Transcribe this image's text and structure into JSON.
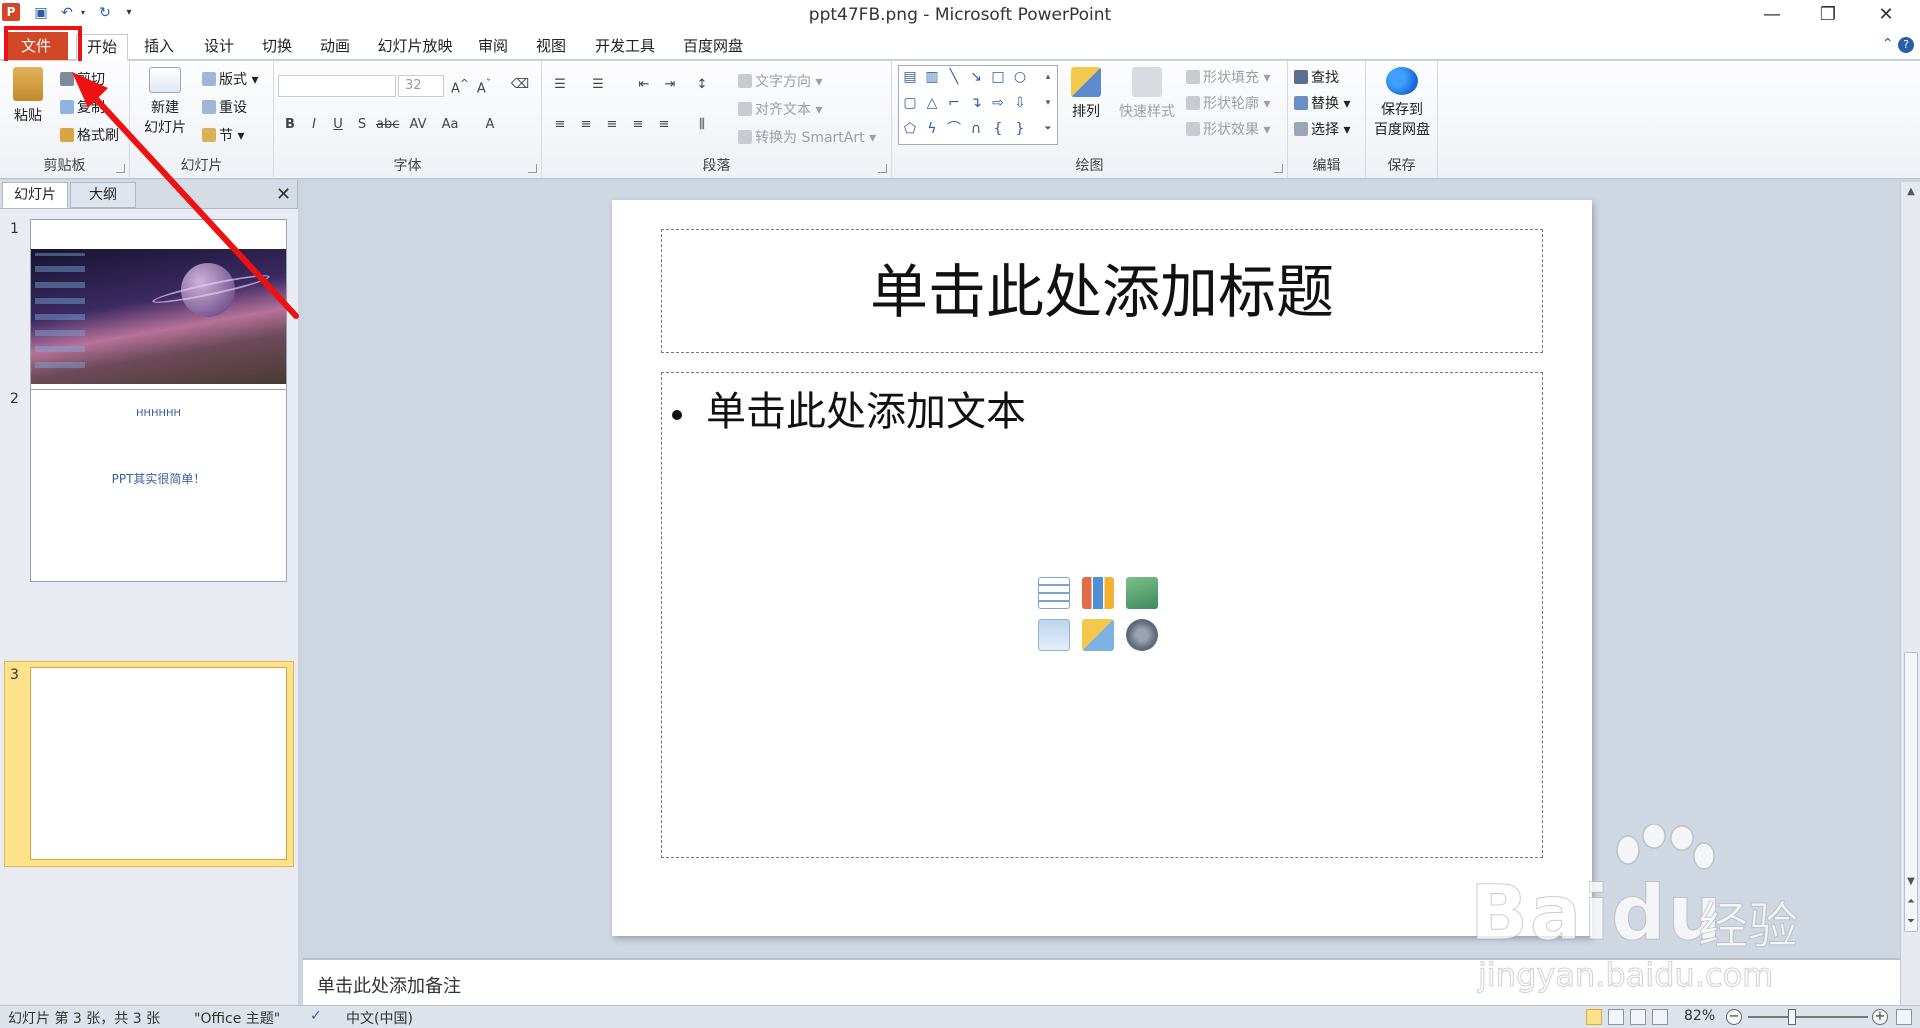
{
  "window": {
    "title": "ppt47FB.png - Microsoft PowerPoint",
    "app_logo": "P",
    "controls": [
      "—",
      "❐",
      "✕"
    ]
  },
  "qat": {
    "save_icon": "save-icon",
    "undo_icon": "undo-icon",
    "redo_icon": "redo-icon"
  },
  "tabs": [
    {
      "label": "文件"
    },
    {
      "label": "开始"
    },
    {
      "label": "插入"
    },
    {
      "label": "设计"
    },
    {
      "label": "切换"
    },
    {
      "label": "动画"
    },
    {
      "label": "幻灯片放映"
    },
    {
      "label": "审阅"
    },
    {
      "label": "视图"
    },
    {
      "label": "开发工具"
    },
    {
      "label": "百度网盘"
    }
  ],
  "ribbon": {
    "clipboard": {
      "label": "剪贴板",
      "paste": "粘贴",
      "cut": "剪切",
      "copy": "复制",
      "format_painter": "格式刷"
    },
    "slides": {
      "label": "幻灯片",
      "new_slide": "新建",
      "new_slide2": "幻灯片",
      "layout": "版式",
      "reset": "重设",
      "section": "节"
    },
    "font": {
      "label": "字体",
      "font_name": "",
      "font_size": "32"
    },
    "paragraph": {
      "label": "段落",
      "text_direction": "文字方向",
      "align_text": "对齐文本",
      "smartart": "转换为 SmartArt"
    },
    "drawing": {
      "label": "绘图",
      "arrange": "排列",
      "quick_styles": "快速样式",
      "shape_fill": "形状填充",
      "shape_outline": "形状轮廓",
      "shape_effects": "形状效果"
    },
    "editing": {
      "label": "编辑",
      "find": "查找",
      "replace": "替换",
      "select": "选择"
    },
    "save": {
      "label": "保存",
      "save_to": "保存到",
      "baidu_pan": "百度网盘"
    }
  },
  "panel": {
    "tab_slides": "幻灯片",
    "tab_outline": "大纲",
    "close": "✕",
    "thumbnails": [
      {
        "num": "1"
      },
      {
        "num": "2",
        "title": "HHHHHH",
        "body": "PPT其实很简单！"
      },
      {
        "num": "3"
      }
    ]
  },
  "slide": {
    "title_placeholder": "单击此处添加标题",
    "body_placeholder": "单击此处添加文本"
  },
  "notes": {
    "placeholder": "单击此处添加备注"
  },
  "status": {
    "slide_info": "幻灯片 第 3 张，共 3 张",
    "theme": "\"Office 主题\"",
    "language": "中文(中国)",
    "zoom": "82%",
    "zoom_out": "−",
    "zoom_in": "+"
  },
  "watermark": {
    "brand": "Bai",
    "brand2": "du",
    "jingyan": "经验",
    "url": "jingyan.baidu.com"
  },
  "colors": {
    "file_tab": "#d24726",
    "highlight": "#e11111",
    "selected_thumb": "#fde28b"
  }
}
